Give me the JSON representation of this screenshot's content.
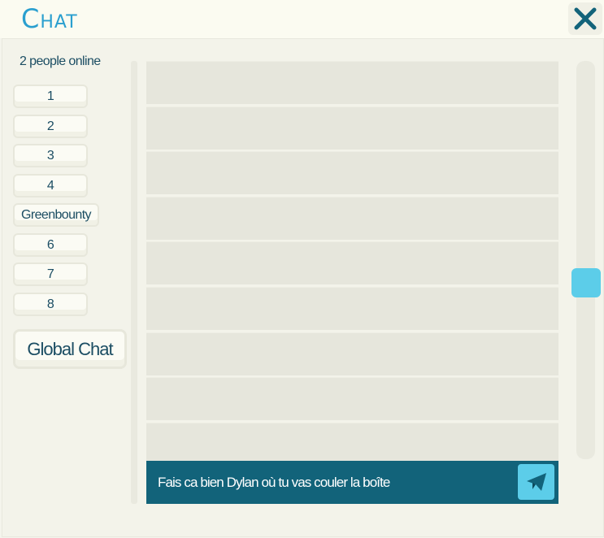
{
  "header": {
    "title": "Chat",
    "close_icon": "close-icon"
  },
  "sidebar": {
    "online_text": "2 people online",
    "rooms": [
      {
        "label": "1"
      },
      {
        "label": "2"
      },
      {
        "label": "3"
      },
      {
        "label": "4"
      },
      {
        "label": "Greenbounty"
      },
      {
        "label": "6"
      },
      {
        "label": "7"
      },
      {
        "label": "8"
      }
    ],
    "global_label": "Global Chat"
  },
  "messages": {
    "rows": [
      "",
      "",
      "",
      "",
      "",
      "",
      "",
      "",
      ""
    ]
  },
  "composer": {
    "value": "Fais ca bien Dylan où tu vas couler la boîte",
    "send_icon": "paper-plane-icon"
  },
  "colors": {
    "accent": "#5ccde9",
    "bar": "#12637a",
    "title": "#2a9fcf",
    "text": "#1b4d63"
  }
}
